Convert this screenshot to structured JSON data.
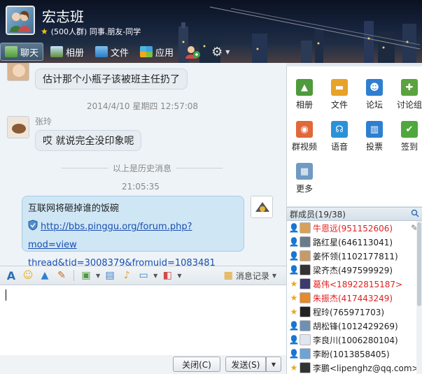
{
  "header": {
    "title": "宏志班",
    "subtitle": "(500人群) 同事.朋友-同学",
    "tabs": [
      {
        "label": "聊天"
      },
      {
        "label": "相册"
      },
      {
        "label": "文件"
      },
      {
        "label": "应用"
      }
    ]
  },
  "chat": {
    "msg1": {
      "text": "估计那个小瓶子该被班主任扔了"
    },
    "time1": "2014/4/10 星期四 12:57:08",
    "msg2": {
      "sender": "张玲",
      "text": "哎 就说完全没印象呢"
    },
    "history_divider": "以上是历史消息",
    "time2": "21:05:35",
    "msg3": {
      "text": "互联网将砸掉谁的饭碗",
      "link_line1": "http://bbs.pinggu.org/forum.php?mod=view",
      "link_line2": "thread&tid=3008379&fromuid=1083481"
    }
  },
  "toolbar": {
    "history_label": "消息记录"
  },
  "footer": {
    "close_label": "关闭(C)",
    "send_label": "发送(S)"
  },
  "apps": [
    {
      "label": "相册",
      "icon": "photo-icon",
      "color": "#4e9a3c"
    },
    {
      "label": "文件",
      "icon": "folder-icon",
      "color": "#e7a227"
    },
    {
      "label": "论坛",
      "icon": "forum-icon",
      "color": "#2f7fd0"
    },
    {
      "label": "讨论组",
      "icon": "discussion-icon",
      "color": "#5aa33e"
    },
    {
      "label": "群视频",
      "icon": "video-icon",
      "color": "#e0683a"
    },
    {
      "label": "语音",
      "icon": "voice-icon",
      "color": "#2a91d8"
    },
    {
      "label": "投票",
      "icon": "vote-icon",
      "color": "#2f7fd0"
    },
    {
      "label": "签到",
      "icon": "checkin-icon",
      "color": "#4ea83b"
    },
    {
      "label": "更多",
      "icon": "more-icon",
      "color": "#6f9ac2"
    }
  ],
  "members_header": "群成员(19/38)",
  "members": [
    {
      "name": "牛恩远(951152606)",
      "red": true,
      "role": "owner",
      "avatar": "#d9a05b"
    },
    {
      "name": "路红星(646113041)",
      "red": false,
      "role": "",
      "avatar": "#6a7b8c"
    },
    {
      "name": "姜怀领(1102177811)",
      "red": false,
      "role": "admin",
      "avatar": "#c79a67"
    },
    {
      "name": "梁齐杰(497599929)",
      "red": false,
      "role": "",
      "avatar": "#333"
    },
    {
      "name": "葛伟<18922815187>",
      "red": true,
      "role": "star",
      "avatar": "#3b3b6e"
    },
    {
      "name": "朱振杰(417443249)",
      "red": true,
      "role": "star",
      "avatar": "#e38b2e"
    },
    {
      "name": "程玲(765971703)",
      "red": false,
      "role": "star",
      "avatar": "#222"
    },
    {
      "name": "胡松锋(1012429269)",
      "red": false,
      "role": "",
      "avatar": "#6f90b5"
    },
    {
      "name": "李良川(1006280104)",
      "red": false,
      "role": "",
      "avatar": "#dfe6ee"
    },
    {
      "name": "李盼(1013858405)",
      "red": false,
      "role": "",
      "avatar": "#6fa2d6"
    },
    {
      "name": "李鹏<lipenghz@qq.com>",
      "red": false,
      "role": "star",
      "avatar": "#333"
    }
  ]
}
